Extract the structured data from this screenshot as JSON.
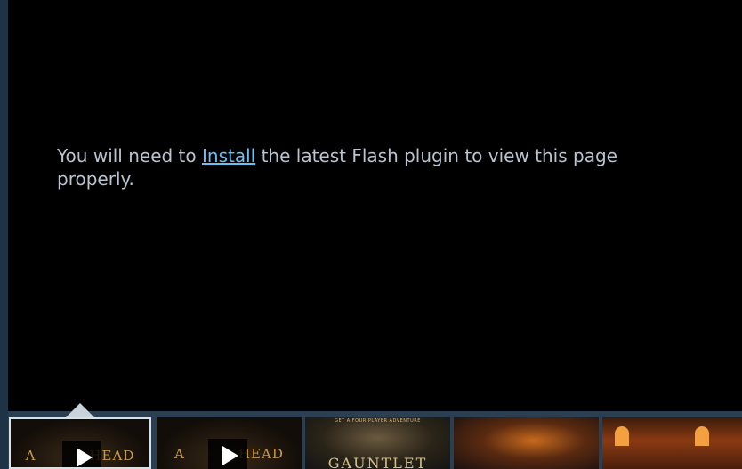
{
  "message": {
    "before": "You will need to ",
    "link": "Install",
    "after": " the latest Flash plugin to view this page properly."
  },
  "thumbnails": [
    {
      "kind": "video",
      "logo_left": "A",
      "logo_right": "HEAD",
      "selected": true
    },
    {
      "kind": "video",
      "logo_left": "A",
      "logo_right": "HEAD",
      "selected": false
    },
    {
      "kind": "screenshot",
      "caption": "GET A FOUR PLAYER ADVENTURE",
      "title": "GAUNTLET"
    },
    {
      "kind": "screenshot"
    },
    {
      "kind": "screenshot"
    }
  ],
  "icons": [
    "play-icon"
  ],
  "colors": {
    "background": "#000000",
    "link": "#67c1f5",
    "text": "#b8c4cf",
    "strip": "#2a3f52"
  }
}
